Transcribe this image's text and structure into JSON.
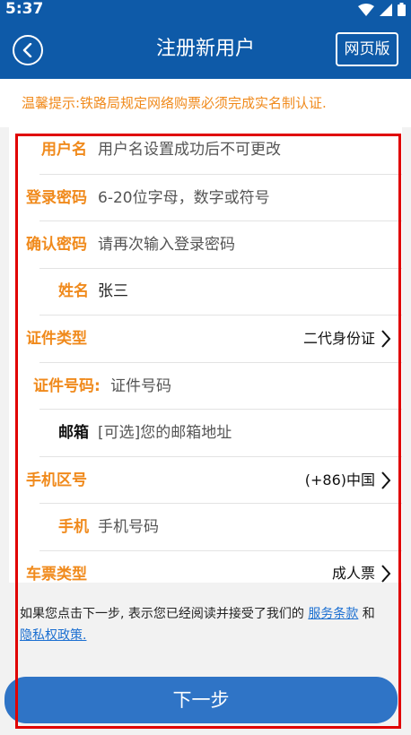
{
  "status": {
    "time": "5:37"
  },
  "appbar": {
    "title": "注册新用户",
    "web_version_label": "网页版"
  },
  "tip": "温馨提示:铁路局规定网络购票必须完成实名制认证.",
  "form": {
    "username": {
      "label": "用户名",
      "placeholder": "用户名设置成功后不可更改"
    },
    "password": {
      "label": "登录密码",
      "placeholder": "6-20位字母，数字或符号"
    },
    "confirm_password": {
      "label": "确认密码",
      "placeholder": "请再次输入登录密码"
    },
    "name": {
      "label": "姓名",
      "value": "张三"
    },
    "id_type": {
      "label": "证件类型",
      "value": "二代身份证"
    },
    "id_number": {
      "label": "证件号码:",
      "placeholder": "证件号码"
    },
    "email": {
      "label": "邮箱",
      "placeholder": "[可选]您的邮箱地址"
    },
    "phone_region": {
      "label": "手机区号",
      "value": "(+86)中国"
    },
    "phone": {
      "label": "手机",
      "placeholder": "手机号码"
    },
    "ticket_type": {
      "label": "车票类型",
      "value": "成人票"
    }
  },
  "agreement": {
    "text": "如果您点击下一步, 表示您已经阅读并接受了我们的 ",
    "service_link": "服务条款",
    "and": " 和 ",
    "privacy_link": "隐私权政策."
  },
  "next_button": "下一步",
  "colors": {
    "primary": "#0e5aa8",
    "accent": "#f08a1c",
    "button": "#2f74c6",
    "link": "#1b6fd1",
    "highlight": "#e00000"
  },
  "icons": {
    "back": "back-arrow-icon",
    "wifi": "wifi-icon",
    "signal": "signal-icon",
    "battery": "battery-icon",
    "chevron": "chevron-right-icon"
  }
}
